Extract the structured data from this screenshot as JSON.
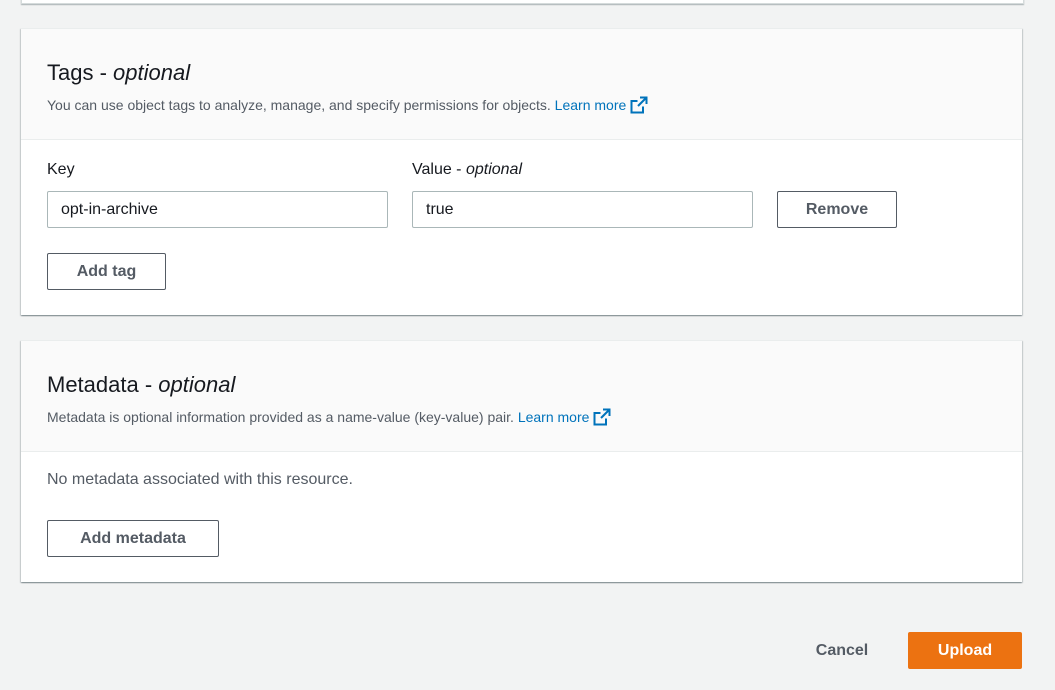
{
  "tags": {
    "title": "Tags - ",
    "title_optional": "optional",
    "description": "You can use object tags to analyze, manage, and specify permissions for objects.",
    "learn_more": "Learn more",
    "key_label": "Key",
    "value_label": "Value - ",
    "value_label_optional": "optional",
    "rows": [
      {
        "key": "opt-in-archive",
        "value": "true"
      }
    ],
    "remove_label": "Remove",
    "add_tag_label": "Add tag"
  },
  "metadata": {
    "title": "Metadata - ",
    "title_optional": "optional",
    "description": "Metadata is optional information provided as a name-value (key-value) pair.",
    "learn_more": "Learn more",
    "empty_text": "No metadata associated with this resource.",
    "add_metadata_label": "Add metadata"
  },
  "footer": {
    "cancel_label": "Cancel",
    "upload_label": "Upload"
  },
  "colors": {
    "link": "#0073bb",
    "primary_button": "#ec7211",
    "page_background": "#f2f3f3"
  },
  "icons": {
    "external_link": "external-link-icon"
  }
}
